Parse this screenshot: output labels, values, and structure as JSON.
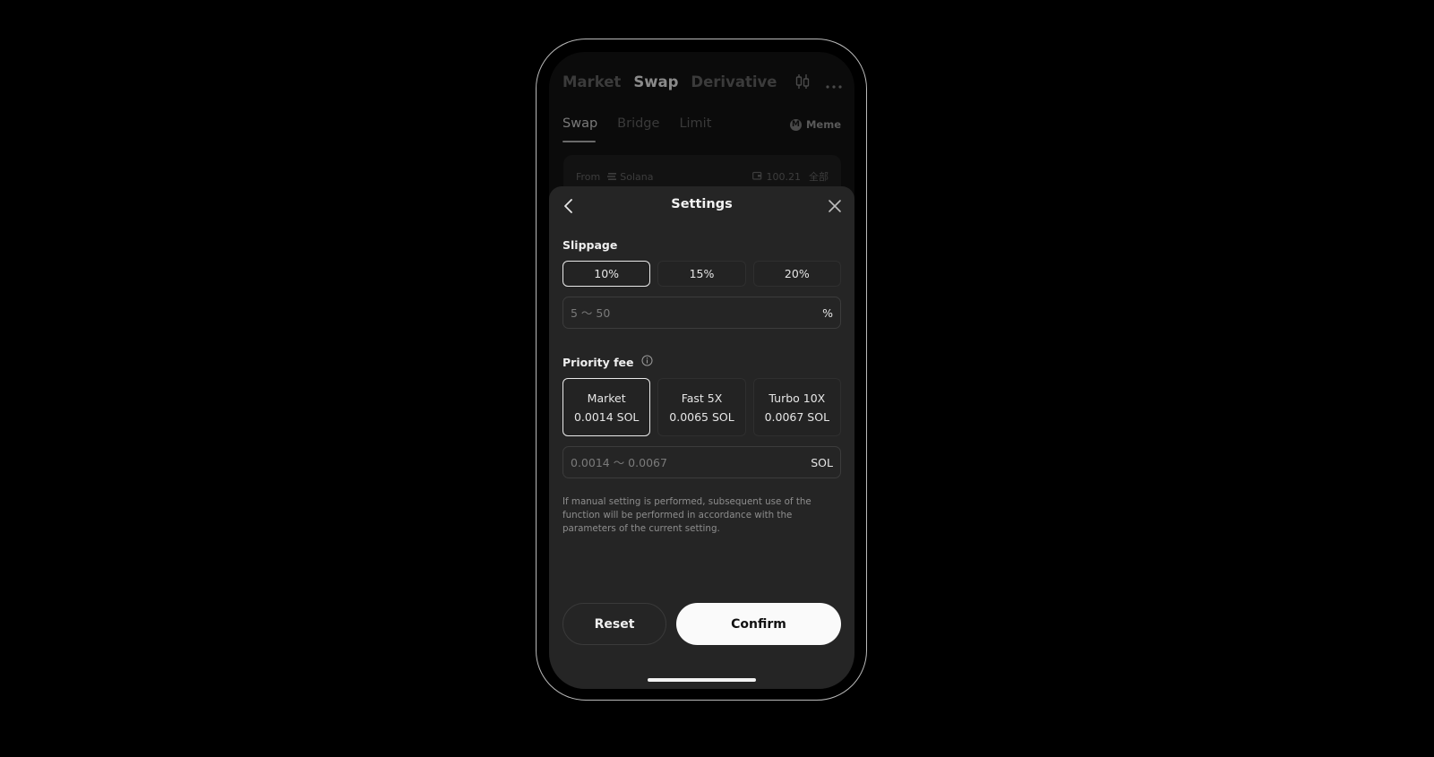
{
  "top_nav": {
    "tabs": [
      {
        "label": "Market",
        "active": false
      },
      {
        "label": "Swap",
        "active": true
      },
      {
        "label": "Derivative",
        "active": false
      }
    ],
    "icons": [
      "candlestick-chart-icon",
      "more-icon"
    ]
  },
  "sub_nav": {
    "tabs": [
      {
        "label": "Swap",
        "active": true
      },
      {
        "label": "Bridge",
        "active": false
      },
      {
        "label": "Limit",
        "active": false
      }
    ],
    "meme": {
      "badge": "M",
      "label": "Meme"
    }
  },
  "from_card": {
    "label": "From",
    "chain": "Solana",
    "balance": "100.21",
    "max_label": "全部"
  },
  "settings": {
    "title": "Settings",
    "slippage": {
      "label": "Slippage",
      "options": [
        {
          "label": "10%",
          "selected": true
        },
        {
          "label": "15%",
          "selected": false
        },
        {
          "label": "20%",
          "selected": false
        }
      ],
      "input_value": "",
      "input_placeholder": "5 ～ 50",
      "unit": "%"
    },
    "priority_fee": {
      "label": "Priority fee",
      "options": [
        {
          "name": "Market",
          "value": "0.0014 SOL",
          "selected": true
        },
        {
          "name": "Fast 5X",
          "value": "0.0065 SOL",
          "selected": false
        },
        {
          "name": "Turbo 10X",
          "value": "0.0067 SOL",
          "selected": false
        }
      ],
      "input_value": "",
      "input_placeholder": "0.0014 ～ 0.0067",
      "unit": "SOL"
    },
    "note": "If manual setting is performed, subsequent use of the function will be performed in accordance with the parameters of the current setting.",
    "reset_label": "Reset",
    "confirm_label": "Confirm"
  },
  "colors": {
    "sheet_bg": "#252525",
    "confirm_bg": "#fafafa",
    "selected_border": "#e8e8e8"
  }
}
